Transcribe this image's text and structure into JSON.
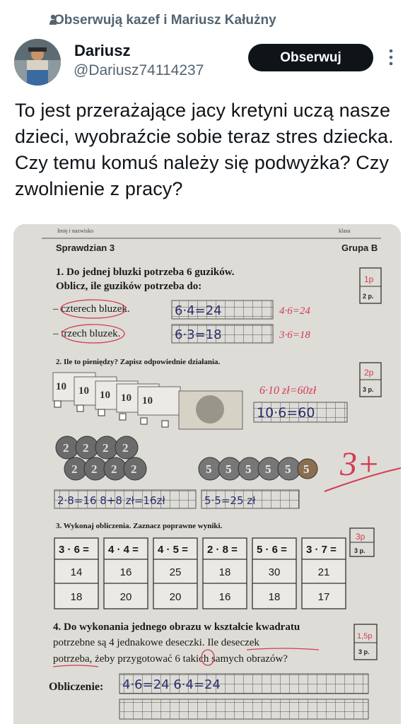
{
  "social_context": {
    "text": "Obserwują kazef i Mariusz Kałużny",
    "icon": "person-icon"
  },
  "author": {
    "name": "Dariusz",
    "handle": "@Dariusz74114237",
    "avatar": "avatar"
  },
  "follow_button": {
    "label": "Obserwuj"
  },
  "more_icon": "more-vertical-icon",
  "tweet_text": "To jest przerażające jacy kretyni uczą nasze dzieci, wyobraźcie sobie teraz stres dziecka. Czy temu komuś należy się podwyżka? Czy zwolnienie z pracy?",
  "worksheet": {
    "name_label": "Imię i nazwisko",
    "class_label": "klasa",
    "title": "Sprawdzian 3",
    "group": "Grupa B",
    "task1": {
      "line1": "1. Do jednej bluzki potrzeba 6 guzików.",
      "line2": "Oblicz, ile guzików potrzeba do:",
      "a_label": "– czterech bluzek.",
      "b_label": "– trzech bluzek.",
      "a_answer": "6·4=24",
      "b_answer": "6·3=18",
      "a_correction": "4·6=24",
      "b_correction": "3·6=18",
      "points_written": "1p",
      "points": "2 p."
    },
    "task2": {
      "title": "2. Ile to pieniędzy? Zapisz odpowiednie działania.",
      "correction": "6·10 zł=60zł",
      "answer1": "10·6=60",
      "answer2": "2·8=16 8+8 zł=16zł",
      "answer3": "5·5=25 zł",
      "coins_2": "2",
      "coins_5": "5",
      "points_written": "2p",
      "points": "3 p.",
      "grade": "3+"
    },
    "task3": {
      "title": "3. Wykonaj obliczenia. Zaznacz poprawne wyniki.",
      "columns": [
        {
          "op": "3 · 6 =",
          "a": "14",
          "b": "18"
        },
        {
          "op": "4 · 4 =",
          "a": "16",
          "b": "20"
        },
        {
          "op": "4 · 5 =",
          "a": "25",
          "b": "20"
        },
        {
          "op": "2 · 8 =",
          "a": "18",
          "b": "16"
        },
        {
          "op": "5 · 6 =",
          "a": "30",
          "b": "18"
        },
        {
          "op": "3 · 7 =",
          "a": "21",
          "b": "17"
        }
      ],
      "points_written": "3p",
      "points": "3 p."
    },
    "task4": {
      "line1": "4. Do wykonania jednego obrazu w kształcie kwadratu",
      "line2": "potrzebne są 4 jednakowe deseczki. Ile deseczek",
      "line3": "potrzeba, żeby przygotować 6 takich samych obrazów?",
      "calc_label": "Obliczenie:",
      "answer": "4·6=24 6·4=24",
      "points_written": "1,5p",
      "points": "3 p."
    }
  }
}
